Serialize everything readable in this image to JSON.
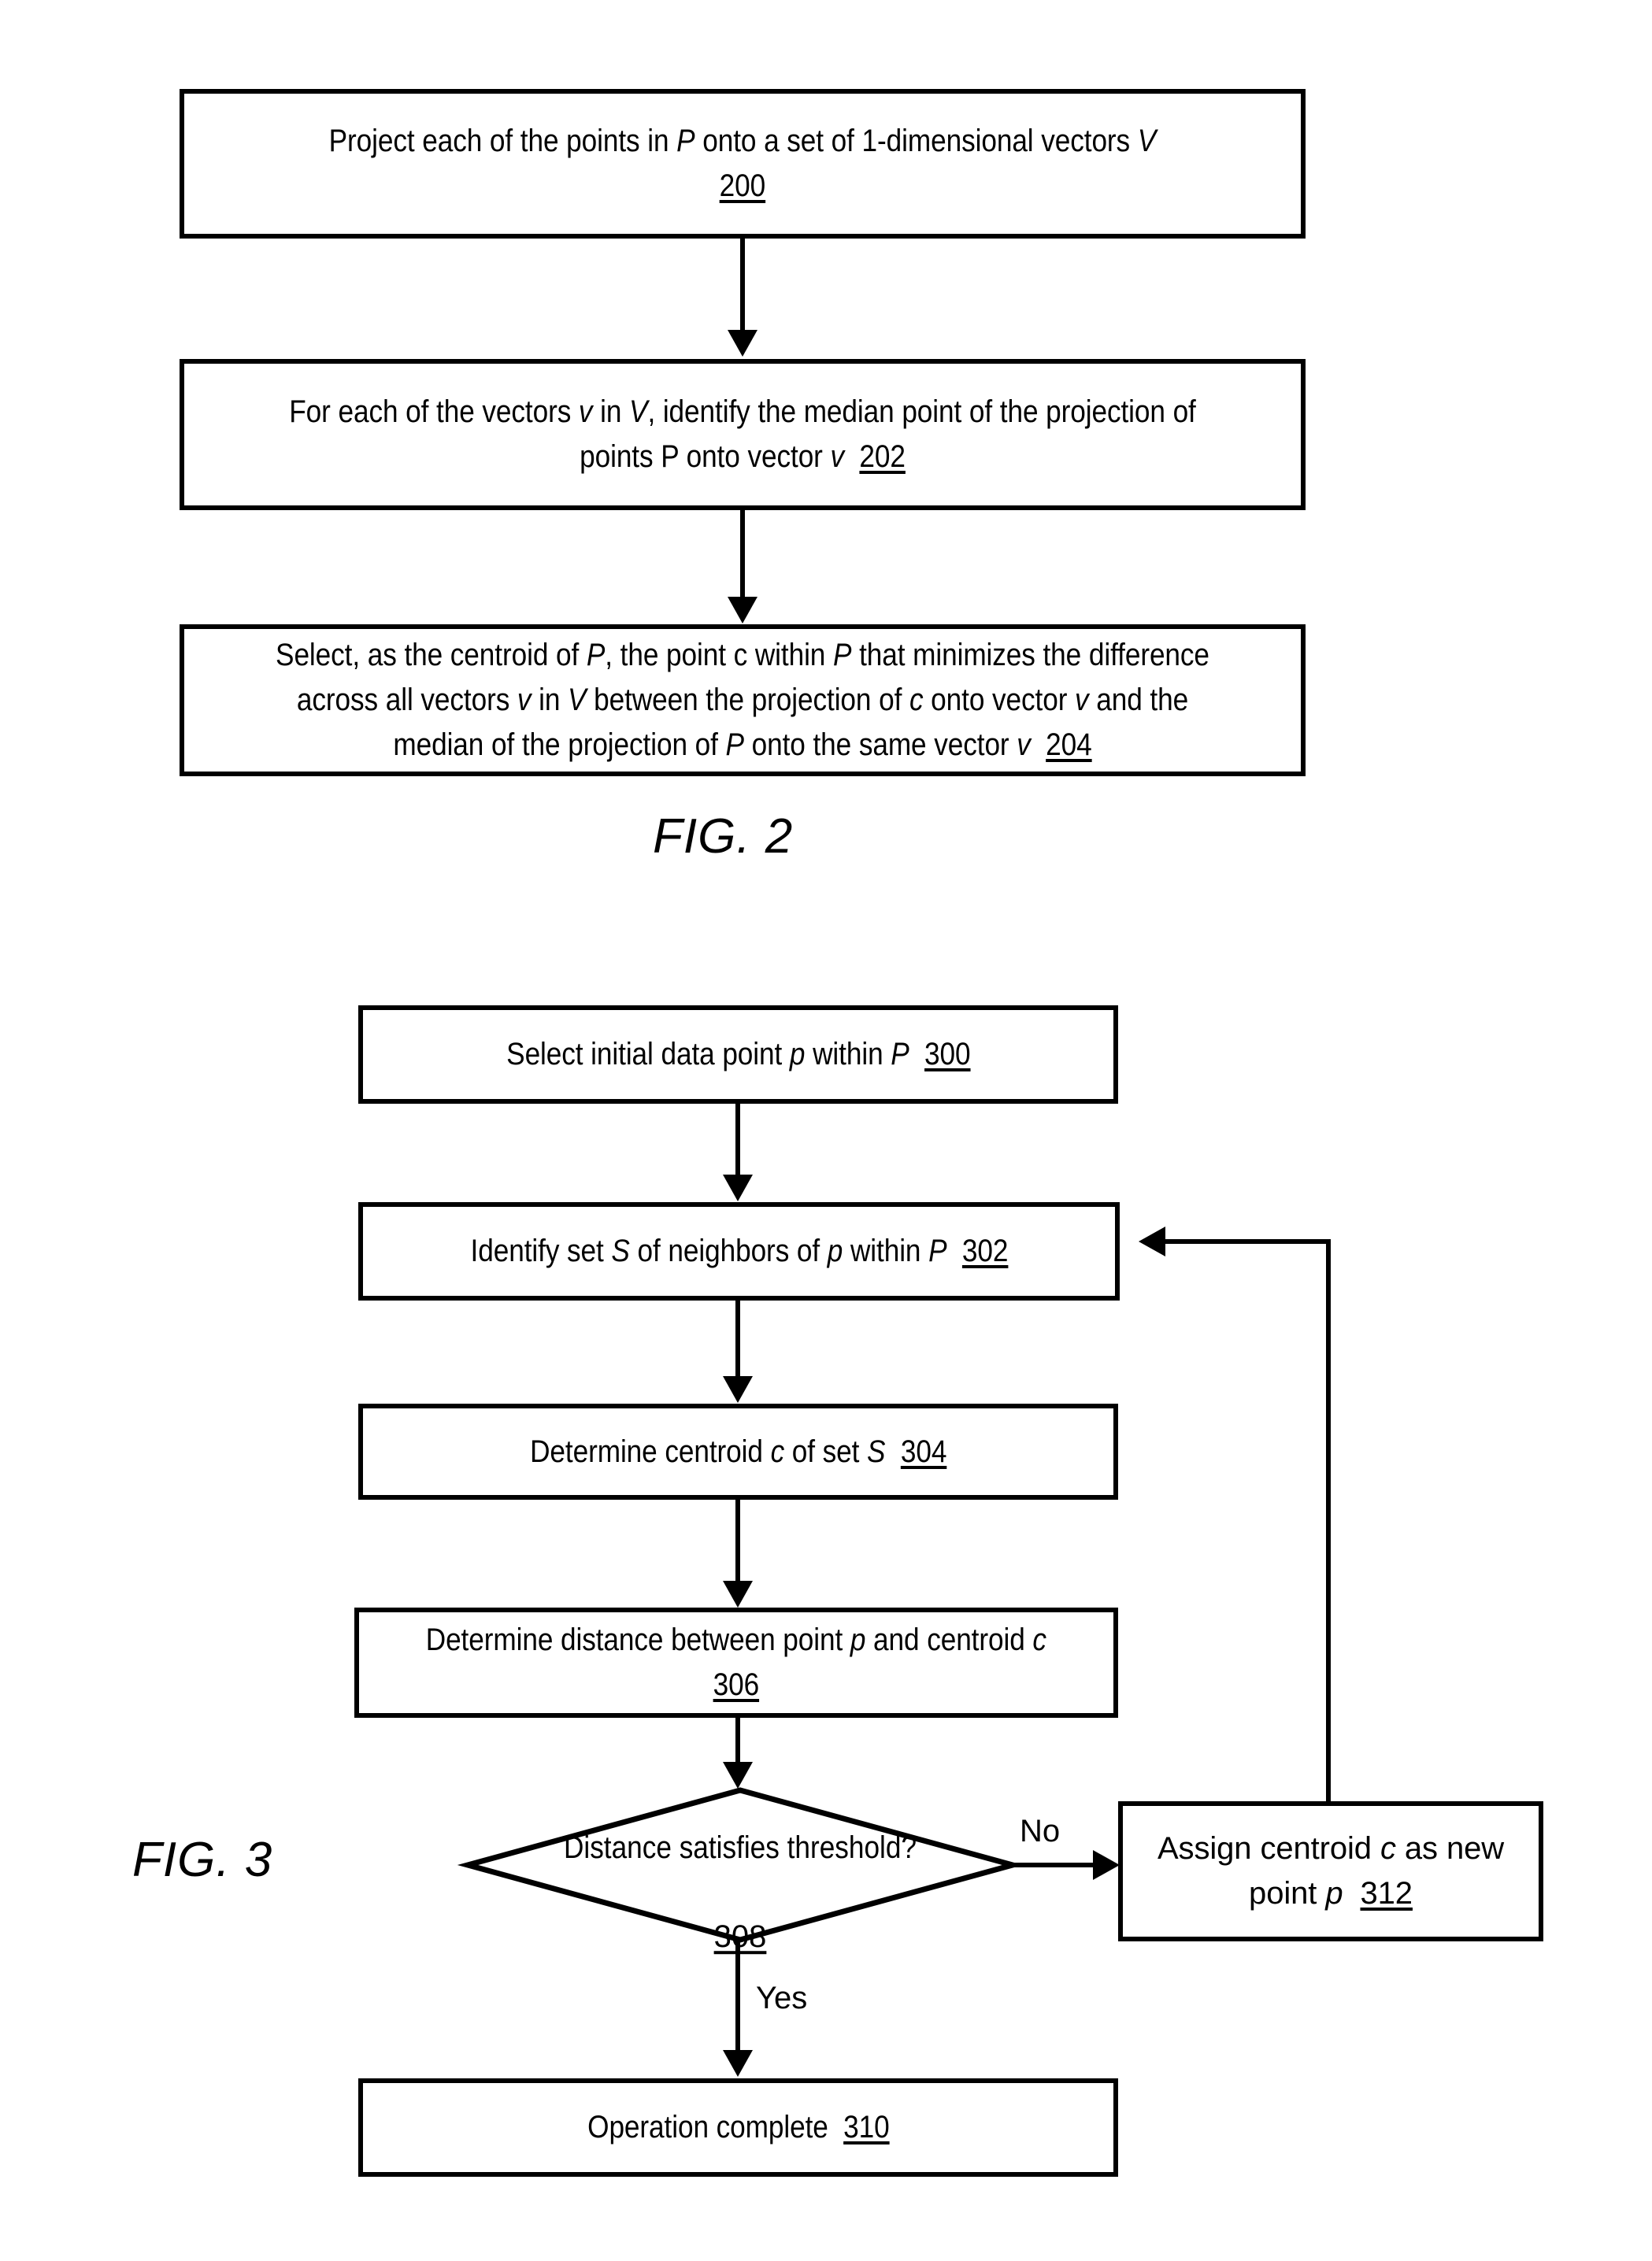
{
  "document": {
    "type": "patent-flowchart-sheet",
    "background_color": "#ffffff",
    "line_color": "#000000"
  },
  "figures": [
    {
      "id": "figure-2",
      "caption": "FIG. 2",
      "nodes": [
        {
          "ref": "200",
          "shape": "rectangle",
          "text_html": "Project each of the points in <i>P</i> onto a set of 1-dimensional vectors <i>V</i>\n<u>200</u>"
        },
        {
          "ref": "202",
          "shape": "rectangle",
          "text_html": "For each of the vectors <i>v</i> in <i>V</i>, identify the median point of the projection of points P onto vector <i>v</i>&nbsp; <u>202</u>"
        },
        {
          "ref": "204",
          "shape": "rectangle",
          "text_html": "Select, as the centroid of <i>P</i>, the point c within <i>P</i> that minimizes the difference across all vectors <i>v</i> in <i>V</i> between the projection of <i>c</i> onto vector <i>v</i> and the median of the projection of <i>P</i> onto the same vector <i>v</i>&nbsp; <u>204</u>"
        }
      ]
    },
    {
      "id": "figure-3",
      "caption": "FIG. 3",
      "nodes": [
        {
          "ref": "300",
          "shape": "rectangle",
          "text_html": "Select initial data point <i>p</i> within <i>P</i>&nbsp; <u>300</u>"
        },
        {
          "ref": "302",
          "shape": "rectangle",
          "text_html": "Identify set <i>S</i> of neighbors of <i>p</i> within <i>P</i>&nbsp; <u>302</u>"
        },
        {
          "ref": "304",
          "shape": "rectangle",
          "text_html": "Determine centroid <i>c</i> of set <i>S</i>&nbsp; <u>304</u>"
        },
        {
          "ref": "306",
          "shape": "rectangle",
          "text_html": "Determine distance between point <i>p</i> and centroid <i>c</i>\n<u>306</u>"
        },
        {
          "ref": "308",
          "shape": "diamond",
          "line1": "Distance satisfies threshold?",
          "line2_html": "<u>308</u>"
        },
        {
          "ref": "310",
          "shape": "rectangle",
          "text_html": "Operation complete&nbsp; <u>310</u>"
        },
        {
          "ref": "312",
          "shape": "rectangle",
          "text_html": "Assign centroid <i>c</i> as new point <i>p</i>&nbsp; <u>312</u>"
        }
      ],
      "edge_labels": {
        "no": "No",
        "yes": "Yes"
      }
    }
  ]
}
